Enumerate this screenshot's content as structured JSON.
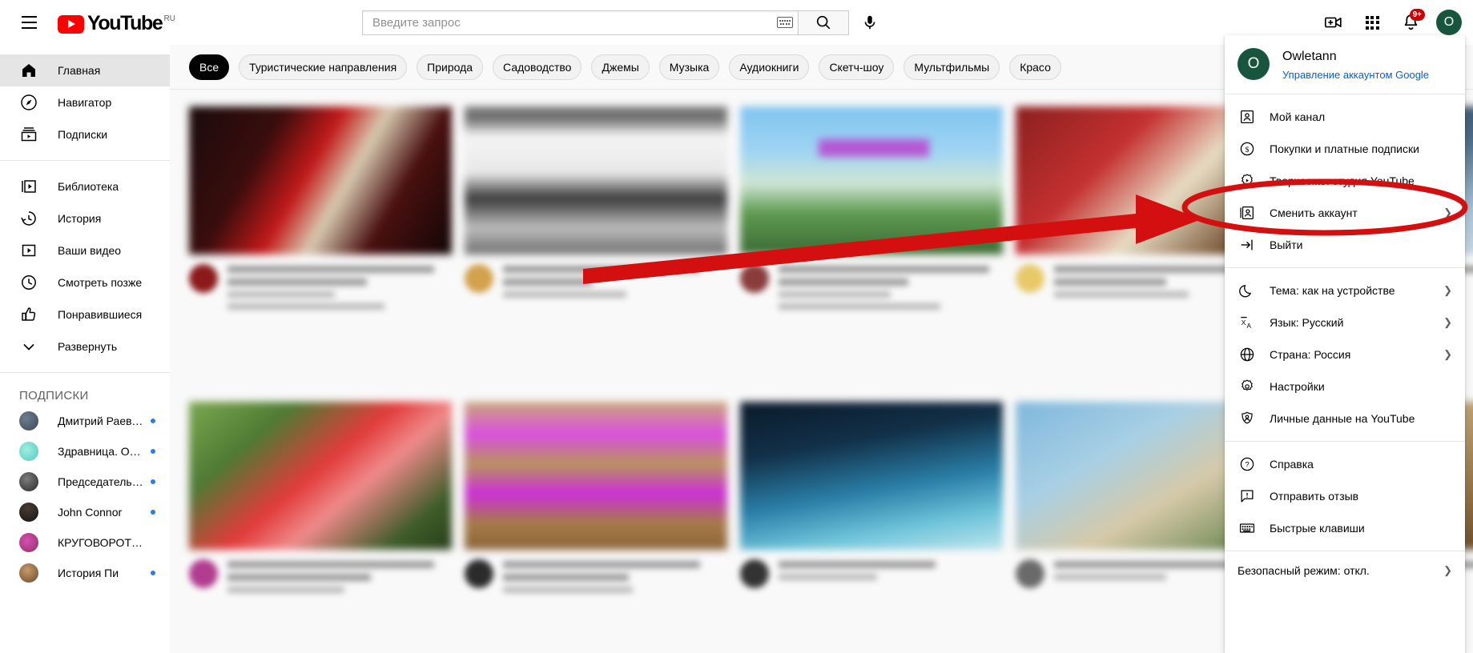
{
  "topbar": {
    "menu_icon": "hamburger-icon",
    "logo_text": "YouTube",
    "logo_country": "RU",
    "search_placeholder": "Введите запрос",
    "search_value": "",
    "keyboard_icon": "keyboard-icon",
    "search_icon": "search-icon",
    "mic_icon": "microphone-icon",
    "create_icon": "video-camera-plus-icon",
    "apps_icon": "apps-grid-icon",
    "notifications_icon": "bell-icon",
    "notifications_badge": "9+",
    "avatar_initial": "O"
  },
  "sidebar": {
    "primary": [
      {
        "label": "Главная",
        "icon": "home-icon",
        "active": true
      },
      {
        "label": "Навигатор",
        "icon": "compass-icon",
        "active": false
      },
      {
        "label": "Подписки",
        "icon": "subscriptions-icon",
        "active": false
      }
    ],
    "secondary": [
      {
        "label": "Библиотека",
        "icon": "library-icon"
      },
      {
        "label": "История",
        "icon": "history-icon"
      },
      {
        "label": "Ваши видео",
        "icon": "your-videos-icon"
      },
      {
        "label": "Смотреть позже",
        "icon": "clock-icon"
      },
      {
        "label": "Понравившиеся",
        "icon": "thumbs-up-icon"
      },
      {
        "label": "Развернуть",
        "icon": "chevron-down-icon"
      }
    ],
    "subscriptions_title": "ПОДПИСКИ",
    "subscriptions": [
      {
        "name": "Дмитрий Раевск…",
        "new": true,
        "color1": "#6b7d8f",
        "color2": "#3d4a57"
      },
      {
        "name": "Здравница. Осно…",
        "new": true,
        "color1": "#9ef0e0",
        "color2": "#55c8bd"
      },
      {
        "name": "Председатель СНТ",
        "new": true,
        "color1": "#7c7c7c",
        "color2": "#2a2a2a"
      },
      {
        "name": "John Connor",
        "new": true,
        "color1": "#4a3b33",
        "color2": "#151515"
      },
      {
        "name": "КРУГОВОРОТ_ДАЧ…",
        "new": false,
        "color1": "#d94fae",
        "color2": "#8e2f6e"
      },
      {
        "name": "История Пи",
        "new": true,
        "color1": "#c79a6a",
        "color2": "#6b4a2c"
      }
    ]
  },
  "chips": [
    {
      "label": "Все",
      "active": true
    },
    {
      "label": "Туристические направления",
      "active": false
    },
    {
      "label": "Природа",
      "active": false
    },
    {
      "label": "Садоводство",
      "active": false
    },
    {
      "label": "Джемы",
      "active": false
    },
    {
      "label": "Музыка",
      "active": false
    },
    {
      "label": "Аудиокниги",
      "active": false
    },
    {
      "label": "Скетч-шоу",
      "active": false
    },
    {
      "label": "Мультфильмы",
      "active": false
    },
    {
      "label": "Красо",
      "active": false
    }
  ],
  "videos": [
    {
      "thumb_bg": "linear-gradient(120deg,#1a0b0b 0%,#3a0d0d 28%,#c21a1a 45%,#d8cab0 58%,#4a1010 75%,#120606 100%)",
      "avatar_color": "#8b1a1a"
    },
    {
      "thumb_bg": "linear-gradient(180deg,#7a7a7a 0%,#6e6e6e 8%,#f4f4f4 20%,#e8e8e8 45%,#3a3a3a 62%,#bdbdbd 82%,#6e6e6e 100%)",
      "avatar_color": "#d2a24c"
    },
    {
      "thumb_bg": "linear-gradient(180deg,#7fc4ef 0%,#9ed4f3 30%,#cfe6d5 52%,#5f9a52 72%,#3b6b34 100%)",
      "avatar_color": "#8a3c3c"
    },
    {
      "thumb_bg": "linear-gradient(135deg,#8b1f1f 0%,#c43030 35%,#e8dcc4 60%,#7d5b3a 85%,#2a1a12 100%)",
      "avatar_color": "#e8c96a"
    },
    {
      "thumb_bg": "linear-gradient(160deg,#2c3c52 0%,#4a6b86 40%,#a8c2d4 70%,#d8e4ec 100%)",
      "avatar_color": "#5d7a92"
    },
    {
      "thumb_bg": "linear-gradient(140deg,#7aa84e 0%,#4f7a34 25%,#e23b3b 48%,#f08a8a 62%,#3d5c28 85%,#2a3d1c 100%)",
      "avatar_color": "#b23c8f"
    },
    {
      "thumb_bg": "linear-gradient(180deg,#c9a878 0%,#d94fe0 22%,#b8945e 42%,#cc2fd8 62%,#a67c4a 82%,#8a6338 100%)",
      "avatar_color": "#2b2b2b"
    },
    {
      "thumb_bg": "linear-gradient(170deg,#0a1a2a 0%,#123048 30%,#2a7fa8 58%,#6fc4da 80%,#bfe6ee 100%)",
      "avatar_color": "#333333"
    },
    {
      "thumb_bg": "linear-gradient(150deg,#7fb8dd 0%,#a8cfe4 35%,#d6c9a8 62%,#8a9a6a 85%,#4a5a38 100%)",
      "avatar_color": "#6a6a6a"
    },
    {
      "thumb_bg": "linear-gradient(150deg,#d8c9a8 0%,#b89a6a 40%,#8a6a3c 70%,#4a3520 100%)",
      "avatar_color": "#7a5a3a"
    }
  ],
  "account_menu": {
    "name": "Owletann",
    "avatar_initial": "O",
    "manage_link": "Управление аккаунтом Google",
    "group1": [
      {
        "label": "Мой канал",
        "icon": "person-box-icon",
        "chevron": false
      },
      {
        "label": "Покупки и платные подписки",
        "icon": "dollar-circle-icon",
        "chevron": false
      },
      {
        "label": "Творческая студия YouTube",
        "icon": "studio-gear-play-icon",
        "chevron": false,
        "highlighted": true
      },
      {
        "label": "Сменить аккаунт",
        "icon": "switch-account-icon",
        "chevron": true
      },
      {
        "label": "Выйти",
        "icon": "sign-out-icon",
        "chevron": false
      }
    ],
    "group2": [
      {
        "label": "Тема: как на устройстве",
        "icon": "moon-icon",
        "chevron": true
      },
      {
        "label": "Язык: Русский",
        "icon": "translate-icon",
        "chevron": true
      },
      {
        "label": "Страна: Россия",
        "icon": "globe-icon",
        "chevron": true
      },
      {
        "label": "Настройки",
        "icon": "gear-icon",
        "chevron": false
      },
      {
        "label": "Личные данные на YouTube",
        "icon": "shield-person-icon",
        "chevron": false
      }
    ],
    "group3": [
      {
        "label": "Справка",
        "icon": "question-circle-icon",
        "chevron": false
      },
      {
        "label": "Отправить отзыв",
        "icon": "feedback-icon",
        "chevron": false
      },
      {
        "label": "Быстрые клавиши",
        "icon": "keyboard-icon",
        "chevron": false
      }
    ],
    "footer": {
      "label": "Безопасный режим: откл.",
      "chevron": true
    }
  },
  "annotations": {
    "arrow_color": "#d40f0f",
    "ellipse_color": "#d40f0f",
    "arrow_name": "red-arrow-pointing-to-youtube-studio",
    "ellipse_name": "red-ellipse-highlight-youtube-studio"
  }
}
